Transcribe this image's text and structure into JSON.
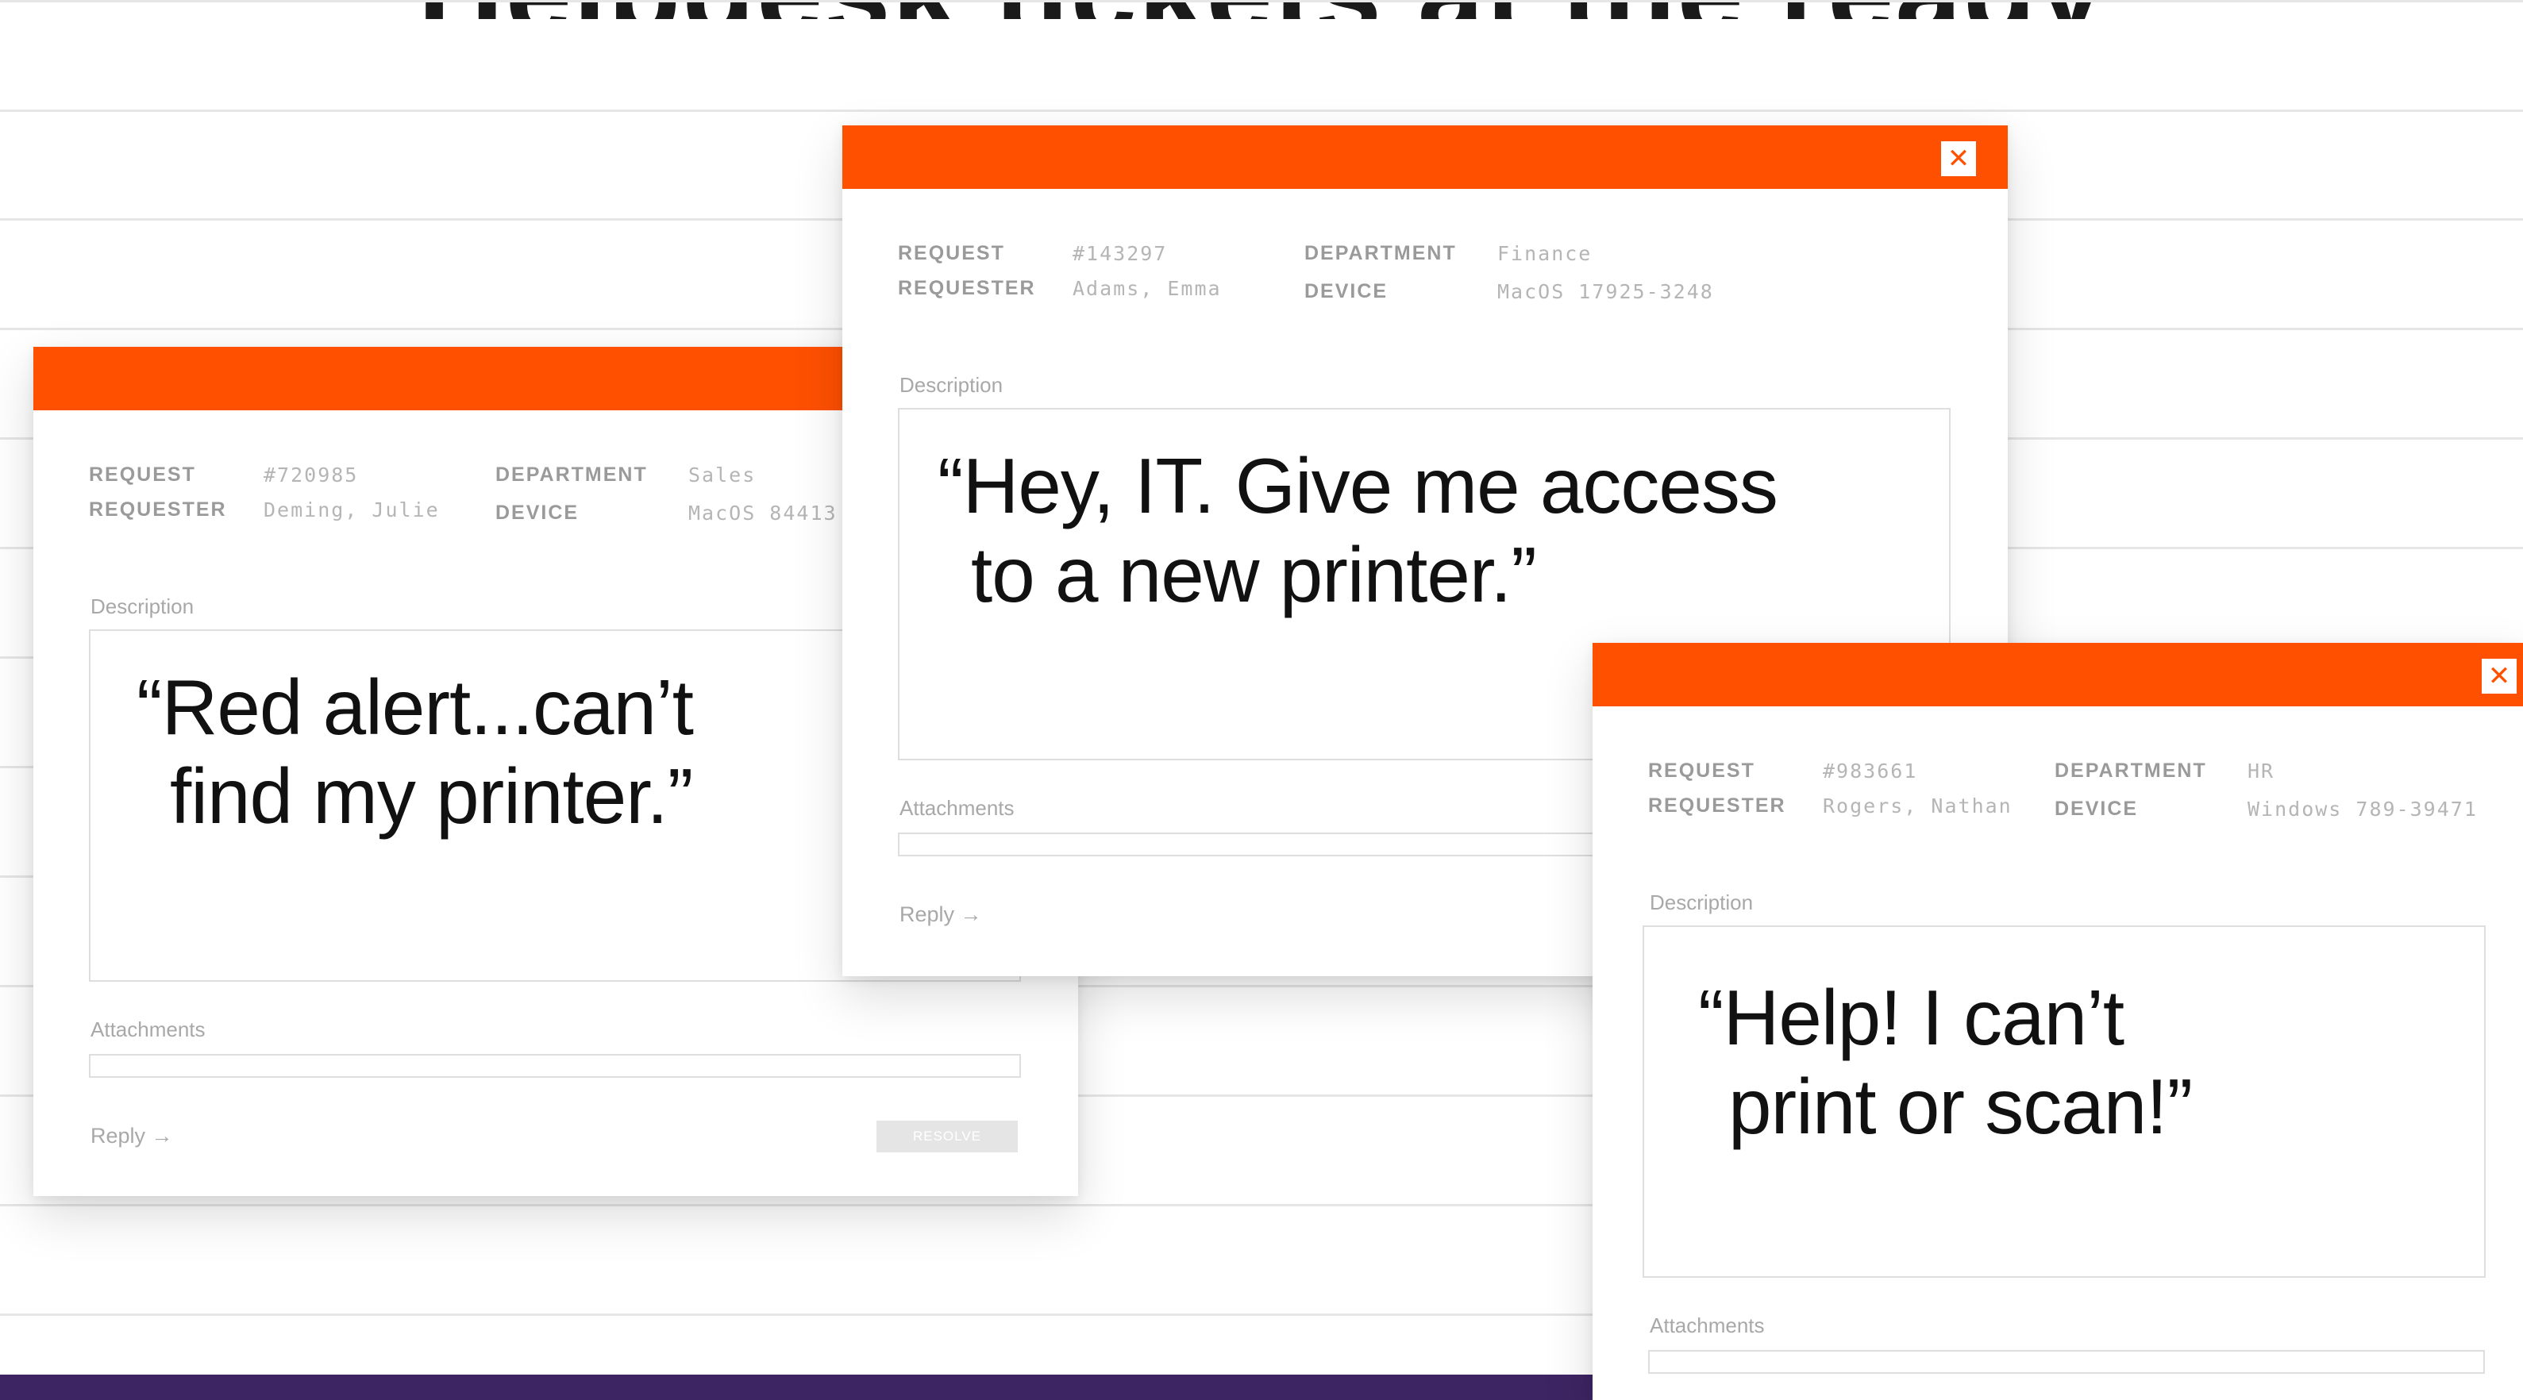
{
  "headline": "Helpdesk tickets at the ready",
  "colors": {
    "accent": "#ff5000",
    "footer": "#3d2563"
  },
  "labels": {
    "request": "REQUEST",
    "requester": "REQUESTER",
    "department": "DEPARTMENT",
    "device": "DEVICE",
    "description": "Description",
    "attachments": "Attachments",
    "reply": "Reply →",
    "resolve": "RESOLVE"
  },
  "close_icon": "close-icon",
  "tickets": [
    {
      "request": "#720985",
      "requester": "Deming, Julie",
      "department": "Sales",
      "device": "MacOS 84413",
      "quote_line1": "“Red alert...can’t",
      "quote_line2": "find my printer.”"
    },
    {
      "request": "#143297",
      "requester": "Adams, Emma",
      "department": "Finance",
      "device": "MacOS 17925-3248",
      "quote_line1": "“Hey, IT. Give me access",
      "quote_line2": "to a new printer.”"
    },
    {
      "request": "#983661",
      "requester": "Rogers, Nathan",
      "department": "HR",
      "device": "Windows 789-39471",
      "quote_line1": "“Help! I can’t",
      "quote_line2": "print or scan!”"
    }
  ]
}
